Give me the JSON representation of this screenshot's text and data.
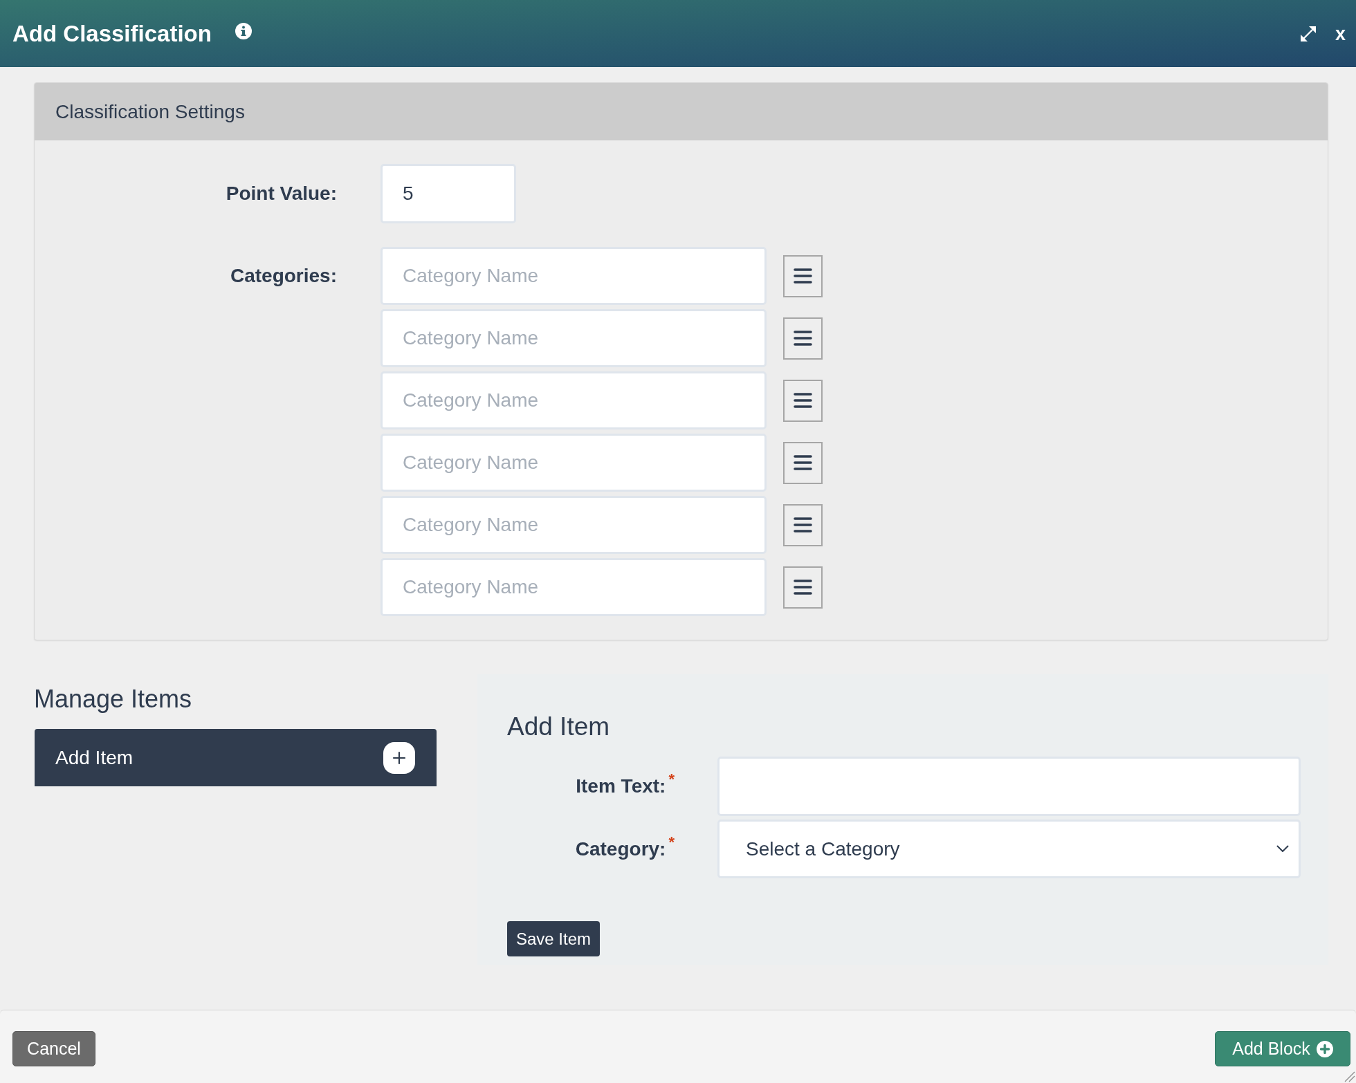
{
  "window": {
    "title": "Add Classification",
    "close_label": "x"
  },
  "settings": {
    "title": "Classification Settings",
    "point_value": {
      "label": "Point Value:",
      "value": "5"
    },
    "categories": {
      "label": "Categories:",
      "rows": [
        {
          "placeholder": "Category Name"
        },
        {
          "placeholder": "Category Name"
        },
        {
          "placeholder": "Category Name"
        },
        {
          "placeholder": "Category Name"
        },
        {
          "placeholder": "Category Name"
        },
        {
          "placeholder": "Category Name"
        }
      ]
    }
  },
  "manage_items": {
    "title": "Manage Items",
    "add_button": {
      "label": "Add Item"
    }
  },
  "add_item_form": {
    "title": "Add Item",
    "fields": [
      {
        "kind": "text",
        "label": "Item Text:",
        "required_mark": "*"
      },
      {
        "kind": "select",
        "label": "Category:",
        "required_mark": "*",
        "value": "Select a Category"
      }
    ],
    "save_button": {
      "label": "Save Item"
    }
  },
  "footer": {
    "buttons": [
      {
        "kind": "secondary",
        "label": "Cancel"
      },
      {
        "kind": "primary",
        "label": "Add Block"
      }
    ]
  }
}
